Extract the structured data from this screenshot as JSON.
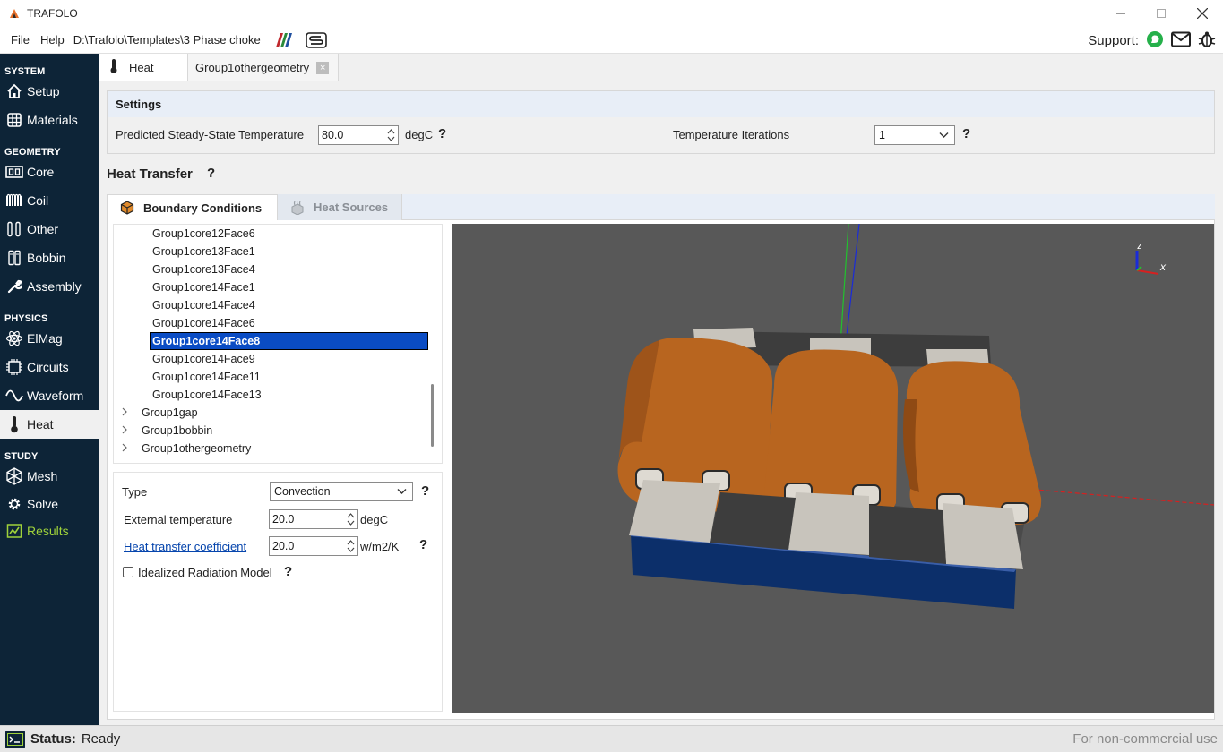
{
  "window": {
    "title": "TRAFOLO"
  },
  "menu": {
    "file": "File",
    "help": "Help",
    "path": "D:\\Trafolo\\Templates\\3 Phase choke",
    "support_label": "Support:"
  },
  "sidebar": {
    "sections": {
      "system": "SYSTEM",
      "geometry": "GEOMETRY",
      "physics": "PHYSICS",
      "study": "STUDY"
    },
    "items": {
      "setup": "Setup",
      "materials": "Materials",
      "core": "Core",
      "coil": "Coil",
      "other": "Other",
      "bobbin": "Bobbin",
      "assembly": "Assembly",
      "elmag": "ElMag",
      "circuits": "Circuits",
      "waveform": "Waveform",
      "heat": "Heat",
      "mesh": "Mesh",
      "solve": "Solve",
      "results": "Results"
    },
    "active": "Heat"
  },
  "doc_tabs": {
    "heat": "Heat",
    "other": "Group1othergeometry",
    "close_glyph": "×"
  },
  "settings": {
    "header": "Settings",
    "temp_label": "Predicted Steady-State Temperature",
    "temp_value": "80.0",
    "temp_unit": "degC",
    "iter_label": "Temperature Iterations",
    "iter_value": "1"
  },
  "heat_transfer": {
    "title": "Heat Transfer",
    "help": "?",
    "tabs": {
      "boundary": "Boundary Conditions",
      "sources": "Heat Sources"
    }
  },
  "tree": {
    "leaves": [
      "Group1core12Face6",
      "Group1core13Face1",
      "Group1core13Face4",
      "Group1core14Face1",
      "Group1core14Face4",
      "Group1core14Face6",
      "Group1core14Face8",
      "Group1core14Face9",
      "Group1core14Face11",
      "Group1core14Face13"
    ],
    "selected_index": 6,
    "groups": [
      "Group1gap",
      "Group1bobbin",
      "Group1othergeometry"
    ]
  },
  "props": {
    "type_label": "Type",
    "type_value": "Convection",
    "ext_temp_label": "External temperature",
    "ext_temp_value": "20.0",
    "ext_temp_unit": "degC",
    "htc_label": "Heat transfer coefficient",
    "htc_value": "20.0",
    "htc_unit": "w/m2/K",
    "radiation_label": "Idealized Radiation Model",
    "radiation_checked": false
  },
  "viewport": {
    "axis_z": "z",
    "axis_x": "x"
  },
  "status": {
    "label": "Status:",
    "value": "Ready",
    "right": "For non-commercial use"
  },
  "colors": {
    "sidebar_bg": "#0d2437",
    "accent": "#e88a3a",
    "selection": "#0a4cc4",
    "results": "#9fd23a",
    "viewport_bg": "#585858",
    "coil": "#b8651f",
    "base": "#0c2f6a"
  }
}
